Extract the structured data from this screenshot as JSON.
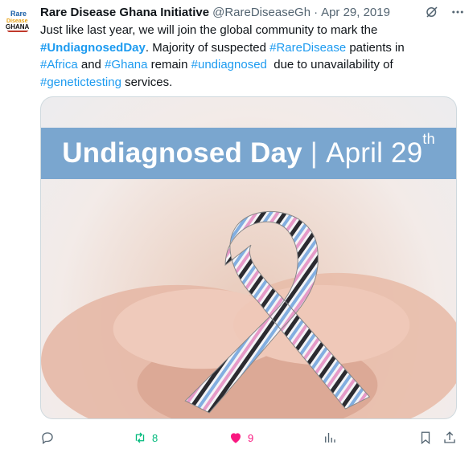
{
  "tweet": {
    "author_name": "Rare Disease Ghana Initiative",
    "handle": "@RareDiseaseGh",
    "separator": "·",
    "date": "Apr 29, 2019",
    "avatar_alt": "Rare Disease Ghana logo",
    "text": {
      "p1": "Just like last year, we will join the global community to mark the",
      "tag1": "#UndiagnosedDay",
      "p2": ". Majority of suspected ",
      "tag2": "#RareDisease",
      "p3": " patients in",
      "tag3": "#Africa",
      "p4": " and ",
      "tag4": "#Ghana",
      "p5": " remain ",
      "tag5": "#undiagnosed",
      "p6": "  due to unavailability of",
      "tag6": "#genetictesting",
      "p7": " services."
    },
    "media": {
      "banner_title": "Undiagnosed Day",
      "banner_sep": "|",
      "banner_date": "April 29",
      "banner_sup": "th"
    },
    "actions": {
      "reply_count": "",
      "retweet_count": "8",
      "like_count": "9",
      "views_count": ""
    }
  },
  "colors": {
    "accent": "#1d9bf0",
    "retweet": "#00ba7c",
    "like": "#f91880",
    "banner": "#7aa6cf",
    "muted": "#536471"
  },
  "icons": [
    "grok-icon",
    "more-icon",
    "reply-icon",
    "retweet-icon",
    "heart-icon",
    "views-icon",
    "bookmark-icon",
    "share-icon"
  ]
}
